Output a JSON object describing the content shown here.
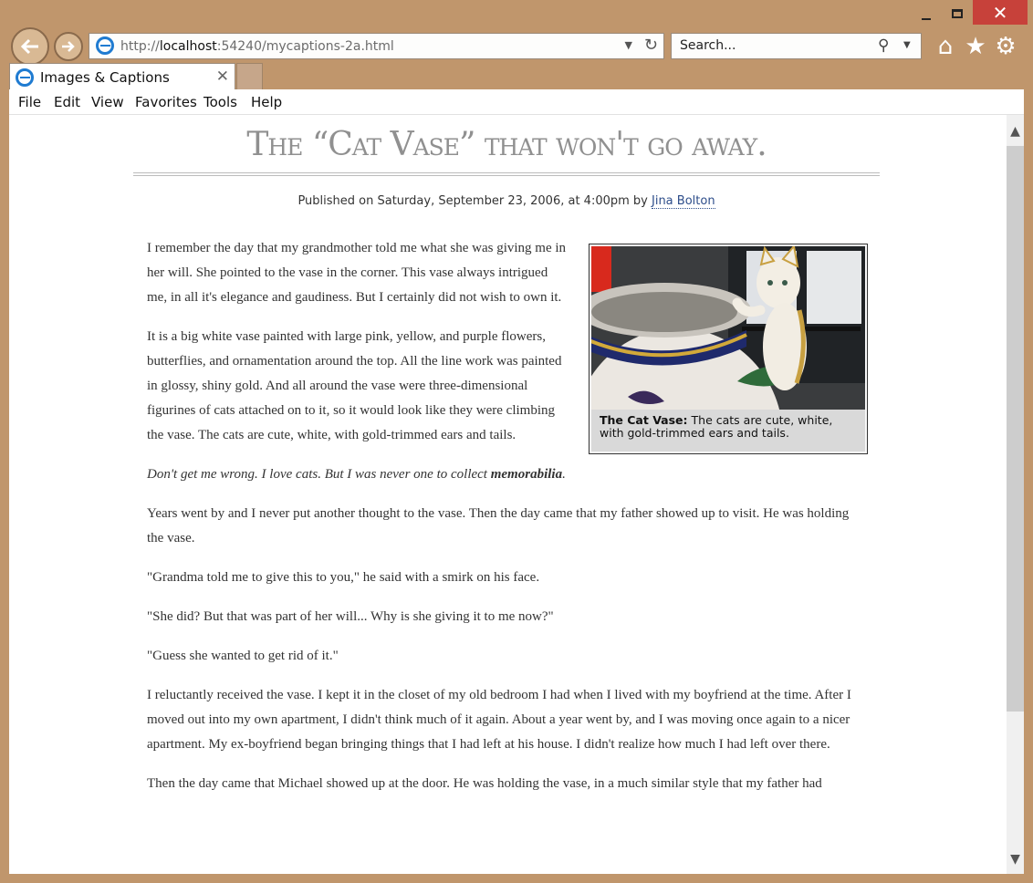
{
  "window": {
    "close_symbol": "✕"
  },
  "address_bar": {
    "protocol": "http://",
    "host": "localhost",
    "path": ":54240/mycaptions-2a.html"
  },
  "search": {
    "placeholder": "Search..."
  },
  "tab": {
    "title": "Images & Captions"
  },
  "menu": [
    "File",
    "Edit",
    "View",
    "Favorites",
    "Tools",
    "Help"
  ],
  "article": {
    "title": "The “Cat Vase” that won't go away.",
    "byline_prefix": "Published on Saturday, September 23, 2006, at 4:00pm by ",
    "author": "Jina Bolton",
    "figure": {
      "caption_label": "The Cat Vase:",
      "caption_text": " The cats are cute, white, with gold-trimmed ears and tails."
    },
    "paragraphs": [
      "I remember the day that my grandmother told me what she was giving me in her will. She pointed to the vase in the corner. This vase always intrigued me, in all it's elegance and gaudiness. But I certainly did not wish to own it.",
      "It is a big white vase painted with large pink, yellow, and purple flowers, butterflies, and ornamentation around the top. All the line work was painted in glossy, shiny gold. And all around the vase were three-dimensional figurines of cats attached on to it, so it would look like they were climbing the vase. The cats are cute, white, with gold-trimmed ears and tails.",
      "Years went by and I never put another thought to the vase. Then the day came that my father showed up to visit. He was holding the vase.",
      "\"Grandma told me to give this to you,\" he said with a smirk on his face.",
      "\"She did? But that was part of her will... Why is she giving it to me now?\"",
      "\"Guess she wanted to get rid of it.\"",
      "I reluctantly received the vase. I kept it in the closet of my old bedroom I had when I lived with my boyfriend at the time. After I moved out into my own apartment, I didn't think much of it again. About a year went by, and I was moving once again to a nicer apartment. My ex-boyfriend began bringing things that I had left at his house. I didn't realize how much I had left over there.",
      "Then the day came that Michael showed up at the door. He was holding the vase, in a much similar style that my father had"
    ],
    "italic_paragraph": {
      "text": "Don't get me wrong. I love cats. But I was never one to collect ",
      "bold": "memorabilia",
      "end": "."
    }
  }
}
